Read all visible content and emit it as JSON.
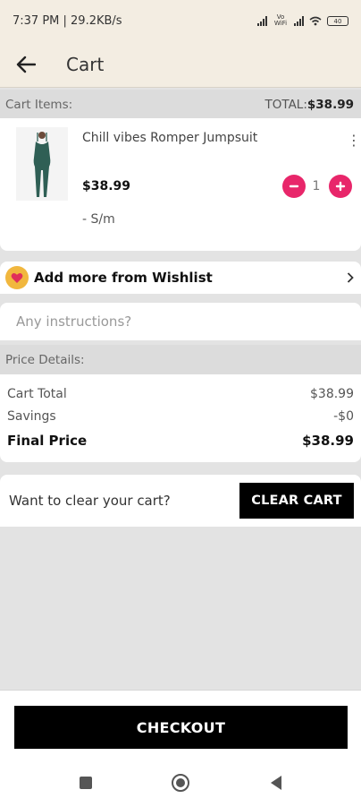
{
  "status": {
    "time": "7:37 PM | 29.2KB/s",
    "battery": "40",
    "network": "Vo WiFi"
  },
  "header": {
    "title": "Cart"
  },
  "cart": {
    "section_label": "Cart Items:",
    "total_label": "TOTAL:",
    "total_value": "$38.99",
    "item": {
      "name": "Chill vibes Romper Jumpsuit",
      "price": "$38.99",
      "size": "- S/m",
      "quantity": "1",
      "menu_icon": "more-vert-icon"
    }
  },
  "wishlist": {
    "label": "Add more from Wishlist"
  },
  "instructions": {
    "placeholder": "Any instructions?",
    "value": ""
  },
  "price_details": {
    "section_label": "Price Details:",
    "rows": [
      {
        "label": "Cart Total",
        "value": "$38.99"
      },
      {
        "label": "Savings",
        "value": "-$0"
      }
    ],
    "final": {
      "label": "Final Price",
      "value": "$38.99"
    }
  },
  "clear": {
    "prompt": "Want to clear your cart?",
    "button": "CLEAR CART"
  },
  "checkout": {
    "button": "CHECKOUT"
  },
  "colors": {
    "accent": "#e8266a",
    "heart_badge": "#f1b73e",
    "header_bg": "#f3ede2",
    "product": "#2f5f55"
  }
}
